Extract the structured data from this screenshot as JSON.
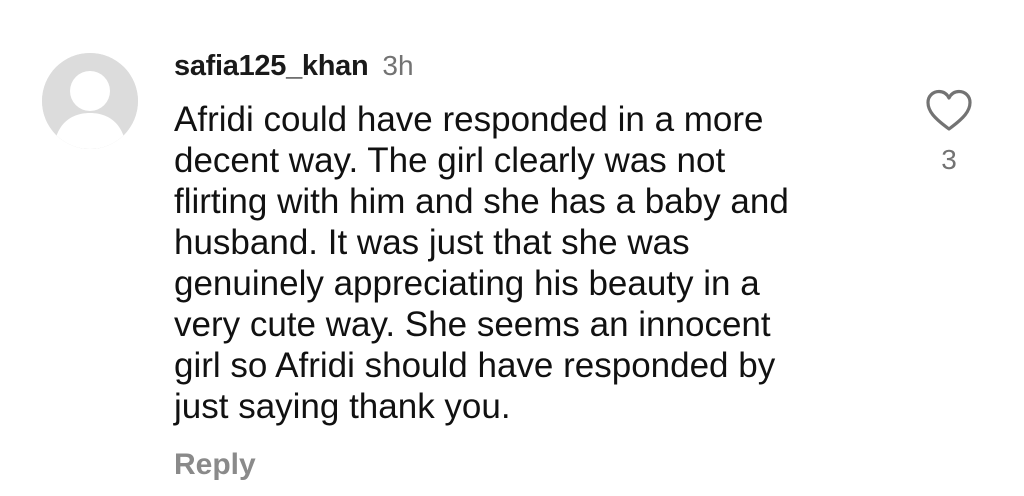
{
  "comment": {
    "username": "safia125_khan",
    "time": "3h",
    "text_lines": [
      "Afridi could have responded in a more",
      "decent way. The girl clearly was not",
      "flirting with him and she has a baby and",
      "husband. It was just that she was",
      "genuinely appreciating his beauty in a",
      "very cute way. She seems an innocent",
      "girl so Afridi should have responded by",
      "just saying thank you."
    ],
    "reply_label": "Reply",
    "like_count": "3",
    "avatar_icon": "default-avatar-icon",
    "like_icon": "heart-outline-icon"
  },
  "colors": {
    "text": "#111111",
    "muted": "#737373",
    "reply": "#8a8a8a",
    "avatar_bg": "#dcdcdc",
    "avatar_fg": "#ffffff"
  }
}
